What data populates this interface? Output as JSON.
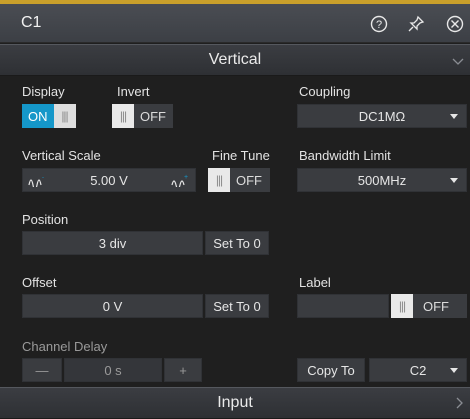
{
  "window": {
    "title": "C1",
    "help_icon": "help-circle-icon",
    "pin_icon": "pin-icon",
    "close_icon": "close-circle-icon"
  },
  "sections": {
    "vertical": "Vertical",
    "input": "Input"
  },
  "display": {
    "label": "Display",
    "state": "ON"
  },
  "invert": {
    "label": "Invert",
    "state": "OFF"
  },
  "coupling": {
    "label": "Coupling",
    "value": "DC1MΩ"
  },
  "vertical_scale": {
    "label": "Vertical Scale",
    "value": "5.00 V",
    "decrease_icon": "waveform-decrease-icon",
    "increase_icon": "waveform-increase-icon"
  },
  "fine_tune": {
    "label": "Fine Tune",
    "state": "OFF"
  },
  "bandwidth_limit": {
    "label": "Bandwidth Limit",
    "value": "500MHz"
  },
  "position": {
    "label": "Position",
    "value": "3 div",
    "set_zero": "Set To 0"
  },
  "offset": {
    "label": "Offset",
    "value": "0 V",
    "set_zero": "Set To 0"
  },
  "label_field": {
    "label": "Label",
    "value": "",
    "state": "OFF"
  },
  "channel_delay": {
    "label": "Channel Delay",
    "value": "0 s",
    "minus": "—",
    "plus": "+"
  },
  "copy_to": {
    "button": "Copy To",
    "target": "C2"
  },
  "colors": {
    "accent_on": "#1597c9",
    "top_stripe": "#caa02b"
  }
}
